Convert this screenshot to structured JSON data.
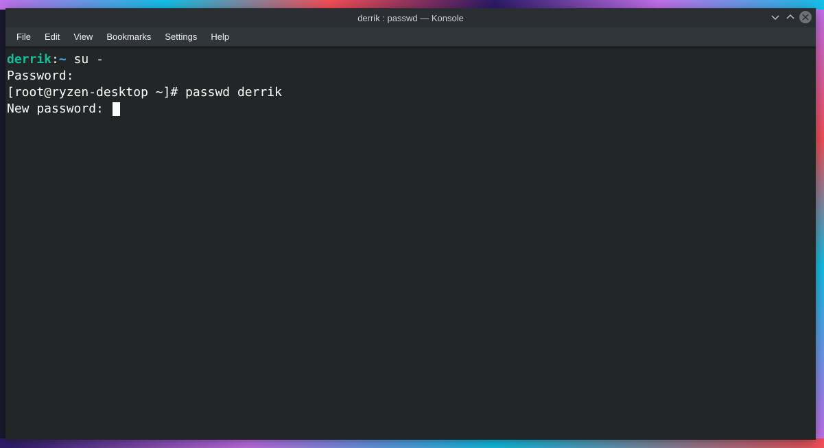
{
  "window": {
    "title": "derrik : passwd — Konsole"
  },
  "menubar": {
    "items": [
      "File",
      "Edit",
      "View",
      "Bookmarks",
      "Settings",
      "Help"
    ]
  },
  "terminal": {
    "line1_user": "derrik",
    "line1_sep": ":",
    "line1_path": "~",
    "line1_cmd": " su -",
    "line2": "Password: ",
    "line3_prompt": "[root@ryzen-desktop ~]# ",
    "line3_cmd": "passwd derrik",
    "line4": "New password: "
  }
}
